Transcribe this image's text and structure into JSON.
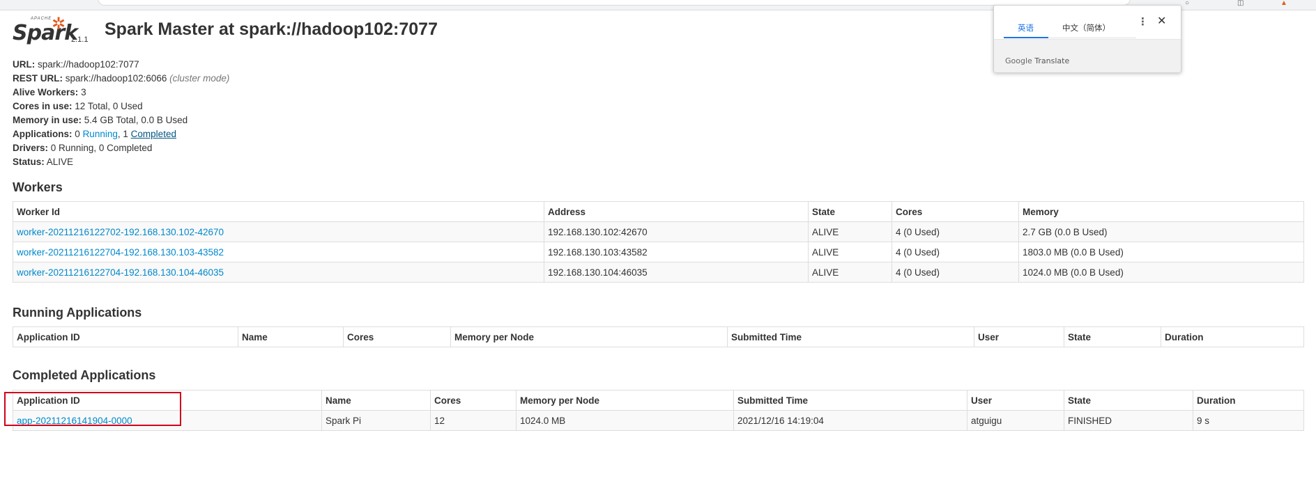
{
  "app": {
    "logo_top": "APACHE",
    "logo_word": "Spark",
    "version": "2.1.1",
    "title": "Spark Master at spark://hadoop102:7077"
  },
  "summary": {
    "url_label": "URL:",
    "url_value": "spark://hadoop102:7077",
    "rest_label": "REST URL:",
    "rest_value": "spark://hadoop102:6066",
    "rest_mode": "(cluster mode)",
    "alive_label": "Alive Workers:",
    "alive_value": "3",
    "cores_label": "Cores in use:",
    "cores_value": "12 Total, 0 Used",
    "memory_label": "Memory in use:",
    "memory_value": "5.4 GB Total, 0.0 B Used",
    "apps_label": "Applications:",
    "apps_running_count": "0",
    "apps_running_link": "Running",
    "apps_sep": ",",
    "apps_completed_count": "1",
    "apps_completed_link": "Completed",
    "drivers_label": "Drivers:",
    "drivers_value": "0 Running, 0 Completed",
    "status_label": "Status:",
    "status_value": "ALIVE"
  },
  "workers": {
    "heading": "Workers",
    "columns": [
      "Worker Id",
      "Address",
      "State",
      "Cores",
      "Memory"
    ],
    "rows": [
      [
        "worker-20211216122702-192.168.130.102-42670",
        "192.168.130.102:42670",
        "ALIVE",
        "4 (0 Used)",
        "2.7 GB (0.0 B Used)"
      ],
      [
        "worker-20211216122704-192.168.130.103-43582",
        "192.168.130.103:43582",
        "ALIVE",
        "4 (0 Used)",
        "1803.0 MB (0.0 B Used)"
      ],
      [
        "worker-20211216122704-192.168.130.104-46035",
        "192.168.130.104:46035",
        "ALIVE",
        "4 (0 Used)",
        "1024.0 MB (0.0 B Used)"
      ]
    ]
  },
  "running_apps": {
    "heading": "Running Applications",
    "columns": [
      "Application ID",
      "Name",
      "Cores",
      "Memory per Node",
      "Submitted Time",
      "User",
      "State",
      "Duration"
    ]
  },
  "completed_apps": {
    "heading": "Completed Applications",
    "columns": [
      "Application ID",
      "Name",
      "Cores",
      "Memory per Node",
      "Submitted Time",
      "User",
      "State",
      "Duration"
    ],
    "rows": [
      [
        "app-20211216141904-0000",
        "Spark Pi",
        "12",
        "1024.0 MB",
        "2021/12/16 14:19:04",
        "atguigu",
        "FINISHED",
        "9 s"
      ]
    ]
  },
  "translate": {
    "tab_source": "英语",
    "tab_target": "中文（简体）",
    "more_glyph": "⋮",
    "close_glyph": "✕",
    "brand_google": "Google",
    "brand_translate": "Translate"
  },
  "colors": {
    "link": "#0088cc",
    "link_visited": "#005580",
    "highlight_box": "#d0021b",
    "spark_orange": "#e25a1c",
    "translate_active": "#1a73e8"
  }
}
